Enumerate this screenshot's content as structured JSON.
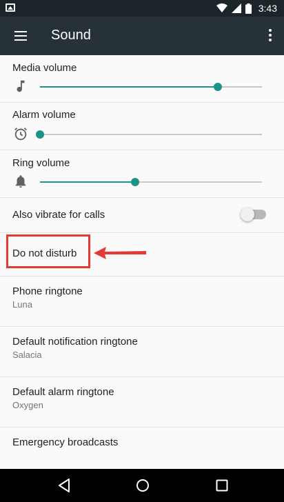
{
  "status_bar": {
    "time": "3:43",
    "icons": [
      "image-icon",
      "wifi-icon",
      "cell-signal-icon",
      "battery-icon"
    ]
  },
  "toolbar": {
    "title": "Sound",
    "menu_icon": "hamburger-menu-icon",
    "overflow_icon": "more-vertical-icon"
  },
  "volumes": [
    {
      "label": "Media volume",
      "icon": "music-note-icon",
      "level": 0.8
    },
    {
      "label": "Alarm volume",
      "icon": "alarm-clock-icon",
      "level": 0.0
    },
    {
      "label": "Ring volume",
      "icon": "bell-icon",
      "level": 0.43
    }
  ],
  "vibrate": {
    "label": "Also vibrate for calls",
    "enabled": false
  },
  "dnd": {
    "label": "Do not disturb"
  },
  "ringtones": [
    {
      "title": "Phone ringtone",
      "value": "Luna"
    },
    {
      "title": "Default notification ringtone",
      "value": "Salacia"
    },
    {
      "title": "Default alarm ringtone",
      "value": "Oxygen"
    }
  ],
  "emergency": {
    "label": "Emergency broadcasts"
  },
  "colors": {
    "accent": "#1a9487",
    "toolbar": "#263238",
    "highlight": "#e53935"
  },
  "nav_bar": {
    "buttons": [
      "back-icon",
      "home-icon",
      "recents-icon"
    ]
  }
}
